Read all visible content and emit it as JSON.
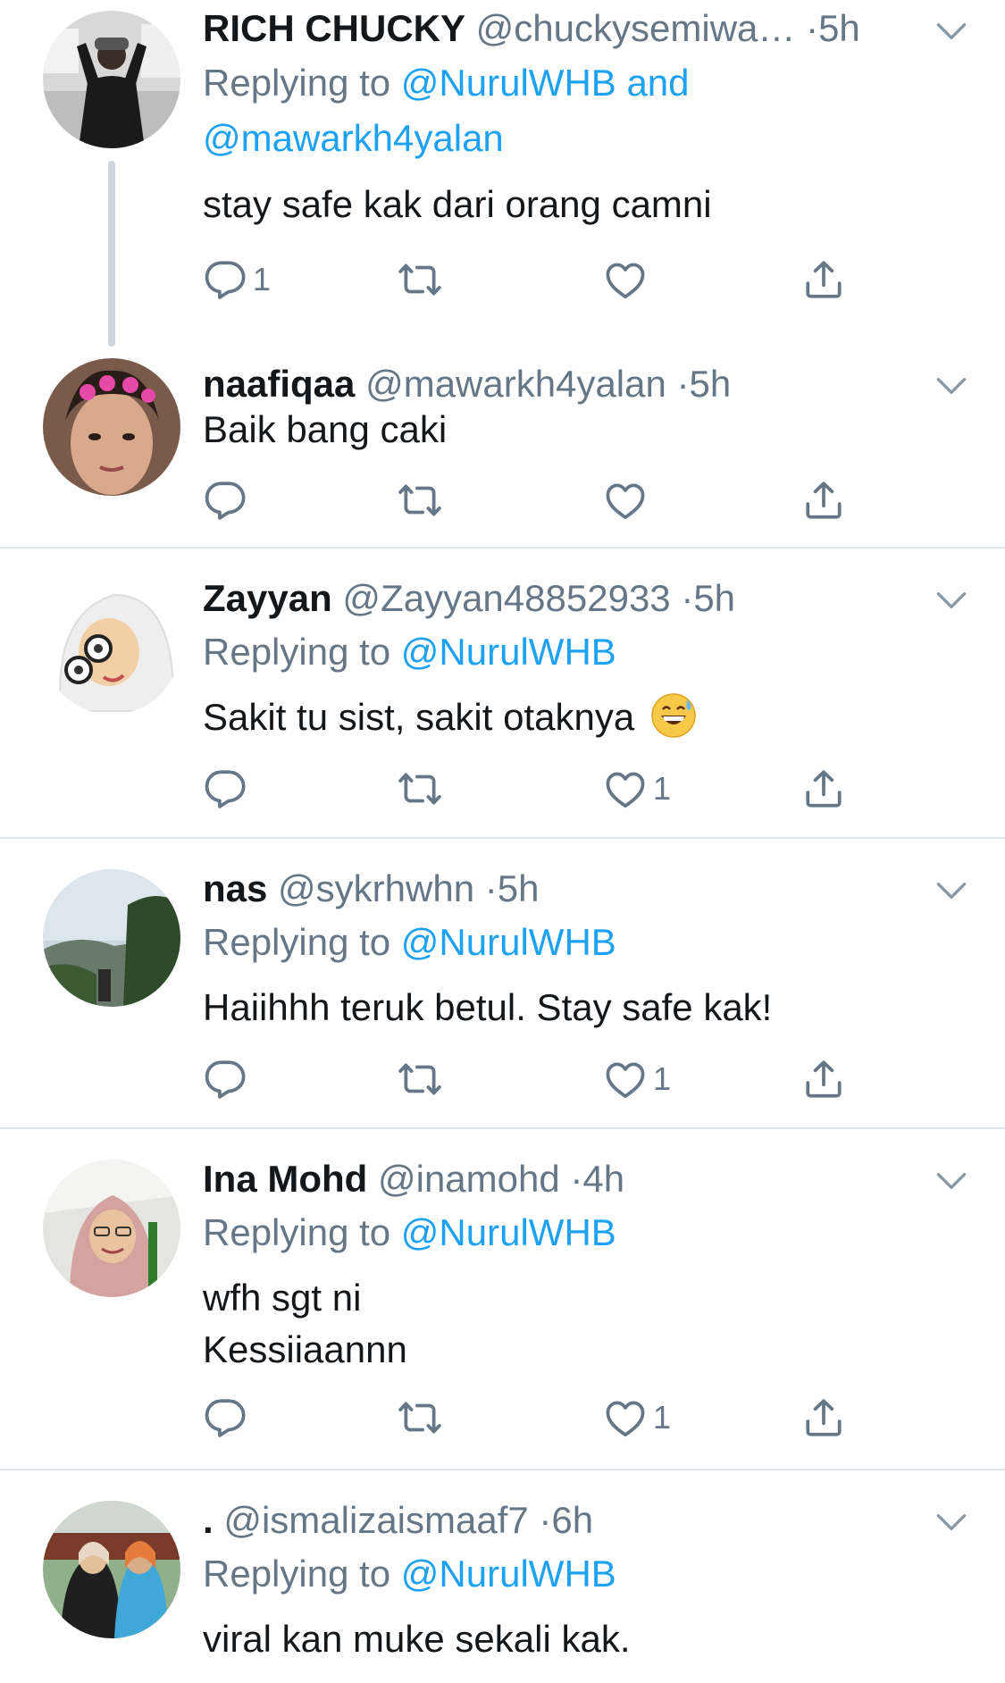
{
  "tweets": [
    {
      "name": "RICH CHUCKY",
      "handle": "@chuckysemiwa…",
      "dot": "·",
      "time": "5h",
      "replying_prefix": "Replying to",
      "replying_mentions": "@NurulWHB and",
      "replying_mentions_2": "@mawarkh4yalan",
      "text": "stay safe kak dari orang camni",
      "reply_count": "1",
      "like_count": ""
    },
    {
      "name": "naafiqaa",
      "handle": "@mawarkh4yalan",
      "dot": "·",
      "time": "5h",
      "text": "Baik bang caki",
      "reply_count": "",
      "like_count": ""
    },
    {
      "name": "Zayyan",
      "handle": "@Zayyan48852933",
      "dot": "·",
      "time": "5h",
      "replying_prefix": "Replying to",
      "replying_mentions": "@NurulWHB",
      "text": "Sakit tu sist, sakit otaknya",
      "reply_count": "",
      "like_count": "1"
    },
    {
      "name": "nas",
      "handle": "@sykrhwhn",
      "dot": "·",
      "time": "5h",
      "replying_prefix": "Replying to",
      "replying_mentions": "@NurulWHB",
      "text": "Haiihhh teruk betul. Stay safe kak!",
      "reply_count": "",
      "like_count": "1"
    },
    {
      "name": "Ina Mohd",
      "handle": "@inamohd",
      "dot": "·",
      "time": "4h",
      "replying_prefix": "Replying to",
      "replying_mentions": "@NurulWHB",
      "text_line1": "wfh sgt ni",
      "text_line2": "Kessiiaannn",
      "reply_count": "",
      "like_count": "1"
    },
    {
      "name": ".",
      "handle": "@ismalizaismaaf7",
      "dot": "·",
      "time": "6h",
      "replying_prefix": "Replying to",
      "replying_mentions": "@NurulWHB",
      "text": "viral kan muke sekali kak."
    }
  ],
  "icons": {
    "reply": "reply-icon",
    "retweet": "retweet-icon",
    "like": "heart-icon",
    "share": "share-icon",
    "caret": "chevron-down-icon",
    "emoji": "grinning-sweat-emoji"
  },
  "colors": {
    "link": "#1da1f2",
    "secondary": "#657786",
    "divider": "#e1e8ed"
  }
}
